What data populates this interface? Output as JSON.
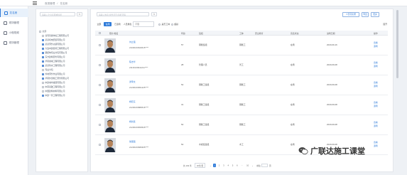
{
  "topbar": {
    "breadcrumb_home": "首頁管理",
    "breadcrumb_sep": "/",
    "breadcrumb_current": "花名册"
  },
  "sidebar": {
    "items": [
      {
        "label": "花名册",
        "icon": "roster-icon",
        "active": true
      },
      {
        "label": "现场管理",
        "icon": "site-icon",
        "active": false
      },
      {
        "label": "小程视频",
        "icon": "video-icon",
        "active": false
      },
      {
        "label": "现场管理",
        "icon": "manage-icon",
        "active": false
      }
    ]
  },
  "tree": {
    "search_placeholder": "请输入企业名称或班组",
    "rows": [
      {
        "label": "全部",
        "level": 1,
        "checked": false
      },
      {
        "label": "合同签署单位工程有限公司",
        "level": 2,
        "checked": false
      },
      {
        "label": "某某机电安装有限公司",
        "level": 2,
        "checked": true
      },
      {
        "label": "某某劳务派遣有限公司",
        "level": 2,
        "checked": true
      },
      {
        "label": "大连中建装饰工程有限公司",
        "level": 2,
        "checked": true
      },
      {
        "label": "钢结构专业分包有限公司",
        "level": 2,
        "checked": true
      },
      {
        "label": "东方建筑劳务有限公司",
        "level": 2,
        "checked": true
      },
      {
        "label": "华南幕墙工程有限公司",
        "level": 2,
        "checked": true
      },
      {
        "label": "某某防水工程有限公司",
        "level": 2,
        "checked": true
      },
      {
        "label": "专业分包",
        "level": 2,
        "checked": false
      },
      {
        "label": "外地劳务作业有限公司",
        "level": 2,
        "checked": true
      },
      {
        "label": "华南外部施工劳务有限公司",
        "level": 2,
        "checked": true
      },
      {
        "label": "中建城市发展有限公司",
        "level": 2,
        "checked": false
      },
      {
        "label": "中南基础工程有限公司",
        "level": 2,
        "checked": false
      },
      {
        "label": "中国建筑材料有限公司",
        "level": 2,
        "checked": false
      },
      {
        "label": "中建一局工程有限公司",
        "level": 2,
        "checked": true
      }
    ]
  },
  "main": {
    "search_placeholder": "请输入姓名/身份证号/手机号码",
    "btn_import": "人员花名册",
    "btn_export": "导出",
    "btn_more": "更多",
    "filters": {
      "chips": [
        "全部",
        "在场",
        "已退场"
      ],
      "active_chip": 1,
      "type_label": "人员角色",
      "type_value": "不限",
      "opt1": "是否工种",
      "opt2": "超龄",
      "more": "展开"
    },
    "columns": [
      "照片/姓名",
      "年龄",
      "班组",
      "工种",
      "安全教育",
      "实名状态",
      "进场日期",
      "操作"
    ],
    "rows": [
      {
        "name": "刘立强",
        "id": "21030219620615****",
        "age": "57",
        "team": "钢筋班组",
        "trade": "钢筋工",
        "safety": "",
        "status": "在场",
        "date": "2020-09-16",
        "op1": "查看",
        "op2": "退场"
      },
      {
        "name": "陈志华",
        "id": "21130219911211****",
        "age": "28",
        "team": "管理人员",
        "trade": "普工",
        "safety": "",
        "status": "在场",
        "date": "2020-09-08",
        "op1": "查看",
        "op2": "退场"
      },
      {
        "name": "谭李文",
        "id": "21230219651225****",
        "age": "54",
        "team": "钢筋工班组",
        "trade": "钢筋工",
        "safety": "",
        "status": "在场",
        "date": "2020-09-08",
        "op1": "查看",
        "op2": "退场"
      },
      {
        "name": "杨晓东",
        "id": "21230219880516****",
        "age": "31",
        "team": "钢筋工班组",
        "trade": "钢筋工",
        "safety": "",
        "status": "在场",
        "date": "2020-09-08",
        "op1": "查看",
        "op2": "退场"
      },
      {
        "name": "杨新民",
        "id": "21230219650526****",
        "age": "54",
        "team": "钢筋工班组",
        "trade": "钢筋工",
        "safety": "",
        "status": "在场",
        "date": "2020-09-08",
        "op1": "查看",
        "op2": "退场"
      },
      {
        "name": "徐国强",
        "id": "21230219680305****",
        "age": "54",
        "team": "木模班班组",
        "trade": "木工",
        "safety": "",
        "status": "在场",
        "date": "2020-09-08",
        "op1": "查看",
        "op2": "退场"
      }
    ],
    "pager": {
      "total": "共 193 条",
      "per_page": "20条/页",
      "prev": "‹",
      "pages": [
        "1",
        "2",
        "3",
        "4",
        "5",
        "6",
        "···",
        "10"
      ],
      "current": 0,
      "next": "›",
      "goto_label": "前往",
      "goto_suffix": "页"
    }
  },
  "watermark": {
    "text": "广联达施工课堂"
  },
  "colors": {
    "accent": "#2f7bd9",
    "sidebar_active_bg": "#e8f1fb"
  }
}
